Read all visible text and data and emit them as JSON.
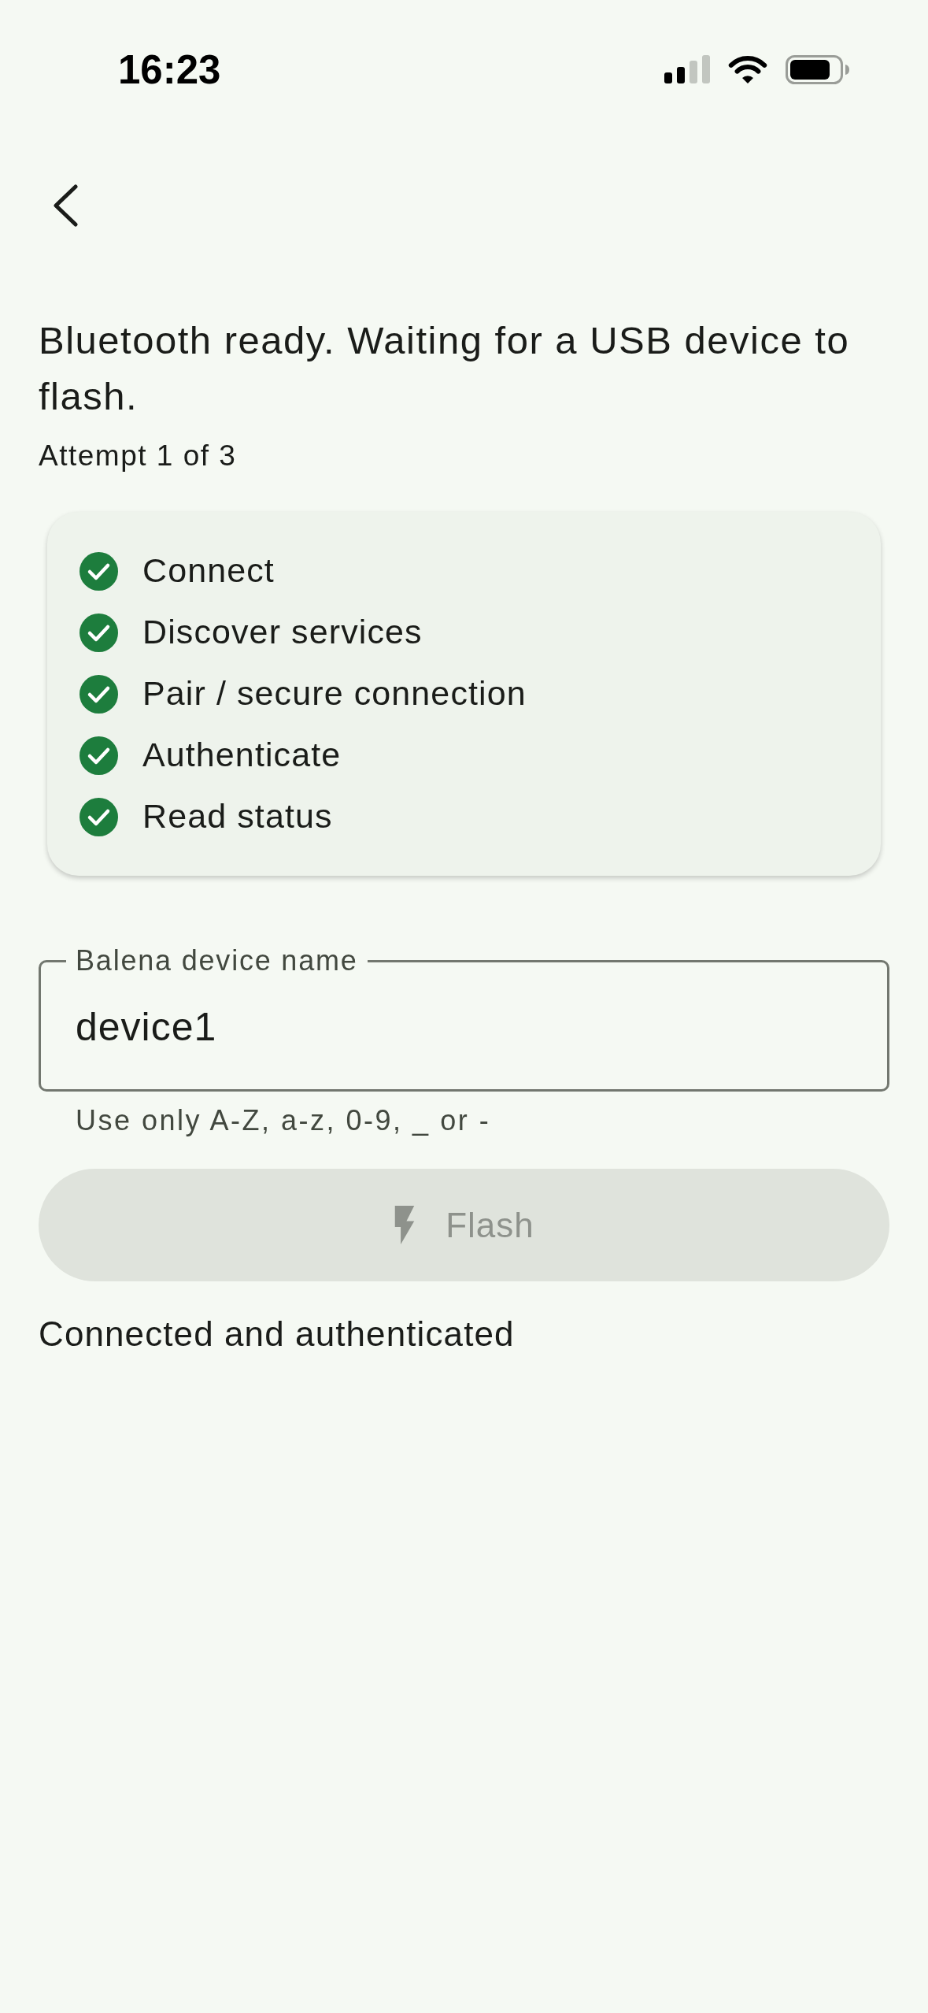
{
  "status_bar": {
    "time": "16:23"
  },
  "header": {
    "title": "Bluetooth ready. Waiting for a USB device to flash.",
    "subtitle": "Attempt 1 of 3"
  },
  "steps": [
    {
      "label": "Connect",
      "done": true
    },
    {
      "label": "Discover services",
      "done": true
    },
    {
      "label": "Pair / secure connection",
      "done": true
    },
    {
      "label": "Authenticate",
      "done": true
    },
    {
      "label": "Read status",
      "done": true
    }
  ],
  "device_name_field": {
    "label": "Balena device name",
    "value": "device1",
    "helper": "Use only A-Z, a-z, 0-9, _ or -"
  },
  "flash_button": {
    "label": "Flash",
    "disabled": true
  },
  "status_message": "Connected and authenticated"
}
